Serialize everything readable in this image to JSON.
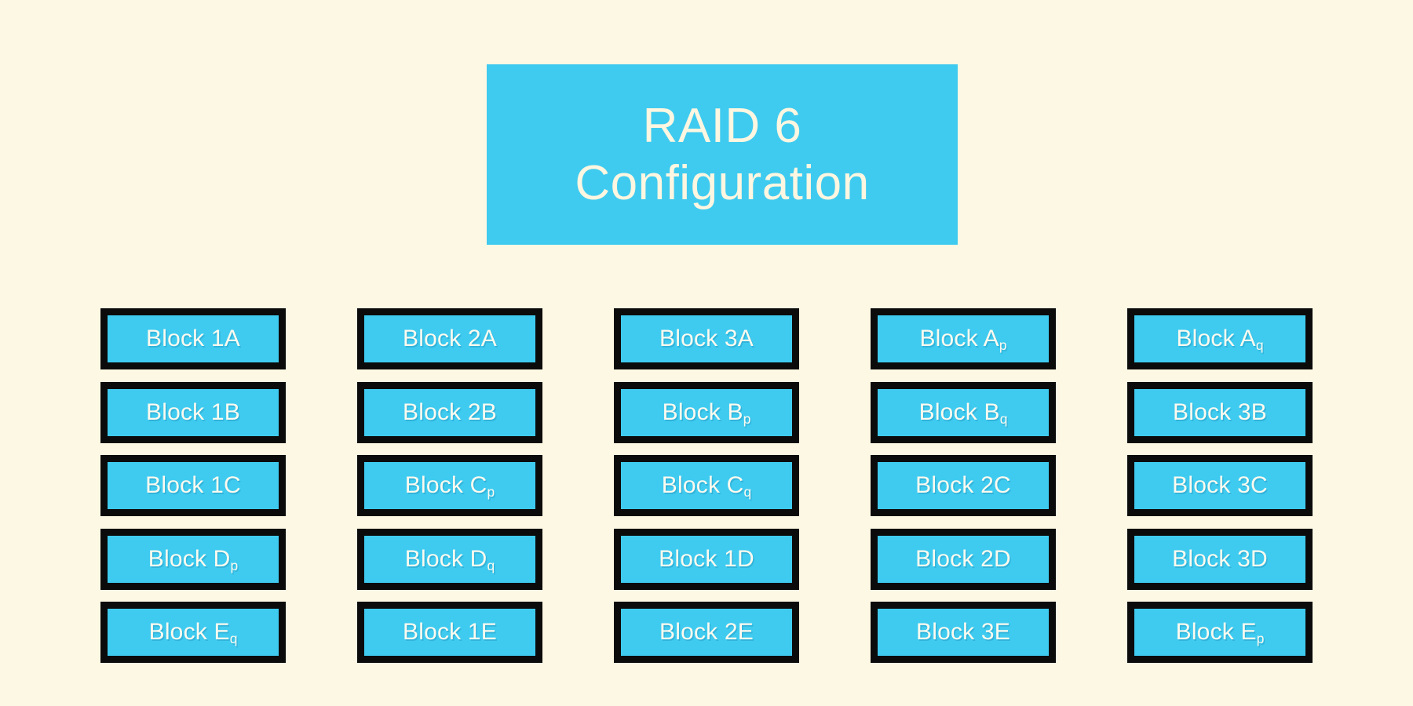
{
  "background_color": "#FDF8E3",
  "accent_color": "#3FCBF0",
  "border_color": "#0B0B0B",
  "text_color": "#FDFAEF",
  "title": {
    "line1": "RAID 6",
    "line2": "Configuration"
  },
  "diagram": {
    "columns": [
      {
        "name": "disk-1",
        "blocks": [
          {
            "base": "Block 1A",
            "sub": ""
          },
          {
            "base": "Block 1B",
            "sub": ""
          },
          {
            "base": "Block 1C",
            "sub": ""
          },
          {
            "base": "Block D",
            "sub": "p"
          },
          {
            "base": "Block E",
            "sub": "q"
          }
        ]
      },
      {
        "name": "disk-2",
        "blocks": [
          {
            "base": "Block 2A",
            "sub": ""
          },
          {
            "base": "Block 2B",
            "sub": ""
          },
          {
            "base": "Block C",
            "sub": "p"
          },
          {
            "base": "Block D",
            "sub": "q"
          },
          {
            "base": "Block 1E",
            "sub": ""
          }
        ]
      },
      {
        "name": "disk-3",
        "blocks": [
          {
            "base": "Block 3A",
            "sub": ""
          },
          {
            "base": "Block B",
            "sub": "p"
          },
          {
            "base": "Block C",
            "sub": "q"
          },
          {
            "base": "Block 1D",
            "sub": ""
          },
          {
            "base": "Block 2E",
            "sub": ""
          }
        ]
      },
      {
        "name": "disk-4",
        "blocks": [
          {
            "base": "Block A",
            "sub": "p"
          },
          {
            "base": "Block B",
            "sub": "q"
          },
          {
            "base": "Block 2C",
            "sub": ""
          },
          {
            "base": "Block 2D",
            "sub": ""
          },
          {
            "base": "Block 3E",
            "sub": ""
          }
        ]
      },
      {
        "name": "disk-5",
        "blocks": [
          {
            "base": "Block A",
            "sub": "q"
          },
          {
            "base": "Block 3B",
            "sub": ""
          },
          {
            "base": "Block 3C",
            "sub": ""
          },
          {
            "base": "Block 3D",
            "sub": ""
          },
          {
            "base": "Block E",
            "sub": "p"
          }
        ]
      }
    ]
  }
}
